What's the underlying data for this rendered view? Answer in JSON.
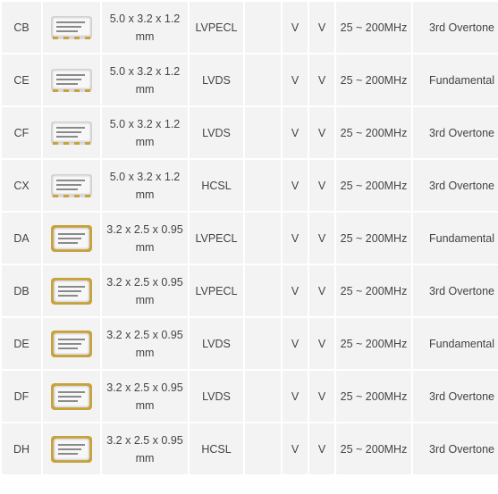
{
  "table": {
    "rows": [
      {
        "series": "CB",
        "size": "5.0 x 3.2 x 1.2 mm",
        "output": "LVPECL",
        "col_a": "",
        "col_b": "V",
        "col_c": "V",
        "freq": "25 ~ 200MHz",
        "mode": "3rd Overtone",
        "package_icon": "ceramic-smd-5032-icon"
      },
      {
        "series": "CE",
        "size": "5.0 x 3.2 x 1.2 mm",
        "output": "LVDS",
        "col_a": "",
        "col_b": "V",
        "col_c": "V",
        "freq": "25 ~ 200MHz",
        "mode": "Fundamental",
        "package_icon": "ceramic-smd-5032-icon"
      },
      {
        "series": "CF",
        "size": "5.0 x 3.2 x 1.2 mm",
        "output": "LVDS",
        "col_a": "",
        "col_b": "V",
        "col_c": "V",
        "freq": "25 ~ 200MHz",
        "mode": "3rd Overtone",
        "package_icon": "ceramic-smd-5032-icon"
      },
      {
        "series": "CX",
        "size": "5.0 x 3.2 x 1.2 mm",
        "output": "HCSL",
        "col_a": "",
        "col_b": "V",
        "col_c": "V",
        "freq": "25 ~ 200MHz",
        "mode": "3rd Overtone",
        "package_icon": "ceramic-smd-5032-icon"
      },
      {
        "series": "DA",
        "size": "3.2 x 2.5 x 0.95 mm",
        "output": "LVPECL",
        "col_a": "",
        "col_b": "V",
        "col_c": "V",
        "freq": "25 ~ 200MHz",
        "mode": "Fundamental",
        "package_icon": "ceramic-smd-3225-icon"
      },
      {
        "series": "DB",
        "size": "3.2 x 2.5 x 0.95 mm",
        "output": "LVPECL",
        "col_a": "",
        "col_b": "V",
        "col_c": "V",
        "freq": "25 ~ 200MHz",
        "mode": "3rd Overtone",
        "package_icon": "ceramic-smd-3225-icon"
      },
      {
        "series": "DE",
        "size": "3.2 x 2.5 x 0.95 mm",
        "output": "LVDS",
        "col_a": "",
        "col_b": "V",
        "col_c": "V",
        "freq": "25 ~ 200MHz",
        "mode": "Fundamental",
        "package_icon": "ceramic-smd-3225-icon"
      },
      {
        "series": "DF",
        "size": "3.2 x 2.5 x 0.95 mm",
        "output": "LVDS",
        "col_a": "",
        "col_b": "V",
        "col_c": "V",
        "freq": "25 ~ 200MHz",
        "mode": "3rd Overtone",
        "package_icon": "ceramic-smd-3225-icon"
      },
      {
        "series": "DH",
        "size": "3.2 x 2.5 x 0.95 mm",
        "output": "HCSL",
        "col_a": "",
        "col_b": "V",
        "col_c": "V",
        "freq": "25 ~ 200MHz",
        "mode": "3rd Overtone",
        "package_icon": "ceramic-smd-3225-icon"
      }
    ]
  },
  "colors": {
    "cell_bg": "#f3f3f3",
    "text": "#444444",
    "package_body": "#e8e8e8",
    "package_pad": "#c9a23a"
  }
}
